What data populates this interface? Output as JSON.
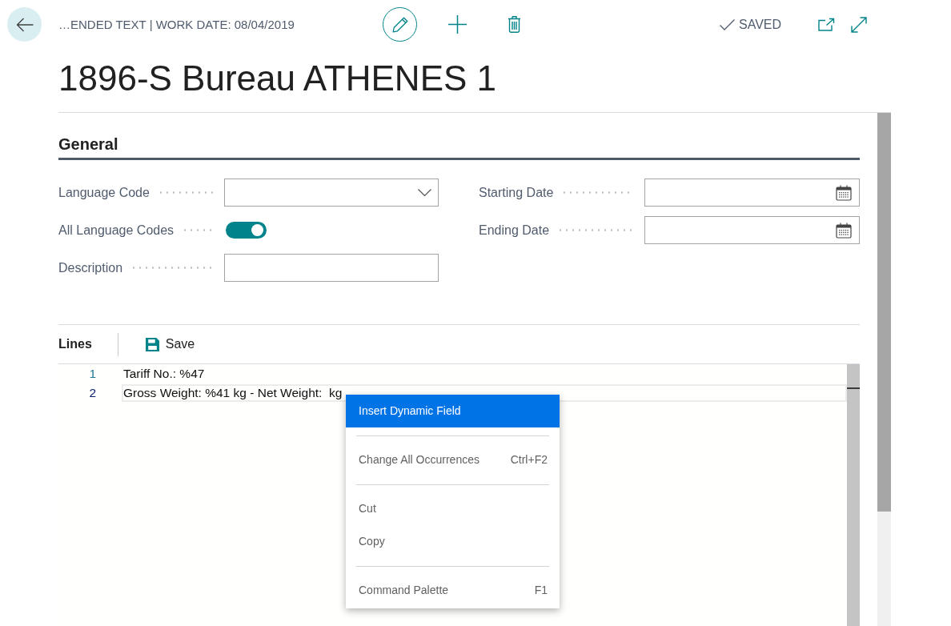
{
  "header": {
    "breadcrumb": "…ENDED TEXT | WORK DATE: 08/04/2019",
    "status": "SAVED"
  },
  "title": "1896-S Bureau ATHENES 1",
  "general": {
    "heading": "General",
    "left_fields": [
      {
        "label": "Language Code",
        "kind": "dropdown"
      },
      {
        "label": "All Language Codes",
        "kind": "toggle",
        "on": true
      },
      {
        "label": "Description",
        "kind": "text"
      }
    ],
    "right_fields": [
      {
        "label": "Starting Date",
        "kind": "date"
      },
      {
        "label": "Ending Date",
        "kind": "date"
      }
    ]
  },
  "lines": {
    "heading": "Lines",
    "action": "Save",
    "editor_lines": [
      {
        "number": "1",
        "text": "Tariff No.: %47",
        "selected": false
      },
      {
        "number": "2",
        "text": "Gross Weight: %41 kg - Net Weight:  kg",
        "selected": true
      }
    ]
  },
  "context_menu": {
    "groups": [
      {
        "items": [
          {
            "label": "Insert Dynamic Field",
            "selected": true
          }
        ]
      },
      {
        "items": [
          {
            "label": "Change All Occurrences",
            "shortcut": "Ctrl+F2",
            "selected": false
          }
        ]
      },
      {
        "items": [
          {
            "label": "Cut",
            "selected": false
          },
          {
            "label": "Copy",
            "selected": false
          }
        ]
      },
      {
        "items": [
          {
            "label": "Command Palette",
            "shortcut": "F1",
            "selected": false
          }
        ]
      }
    ]
  }
}
